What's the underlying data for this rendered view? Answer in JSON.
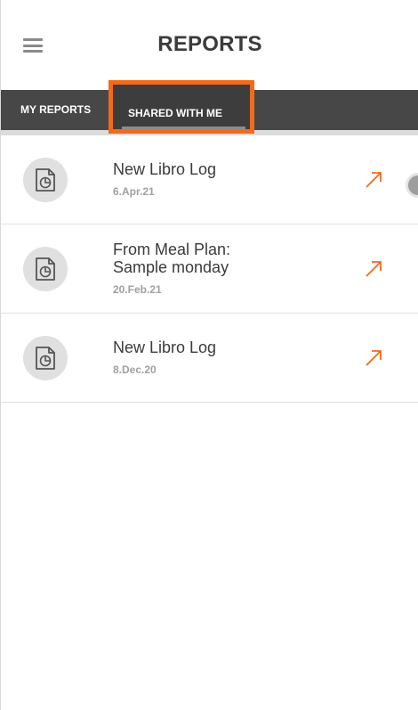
{
  "header": {
    "title": "REPORTS",
    "menu_icon": "hamburger-menu-icon"
  },
  "tabs": [
    {
      "label": "MY REPORTS",
      "selected": false
    },
    {
      "label": "SHARED WITH ME",
      "selected": true
    }
  ],
  "colors": {
    "accent": "#f26a1b",
    "tabbar": "#474747",
    "icon_circle": "#e0e0e0"
  },
  "reports": [
    {
      "title": "New Libro Log",
      "date": "6.Apr.21",
      "icon": "report-chart-icon",
      "action_icon": "open-arrow-icon"
    },
    {
      "title": "From Meal Plan: Sample monday",
      "date": "20.Feb.21",
      "icon": "report-chart-icon",
      "action_icon": "open-arrow-icon"
    },
    {
      "title": "New Libro Log",
      "date": "8.Dec.20",
      "icon": "report-chart-icon",
      "action_icon": "open-arrow-icon"
    }
  ]
}
